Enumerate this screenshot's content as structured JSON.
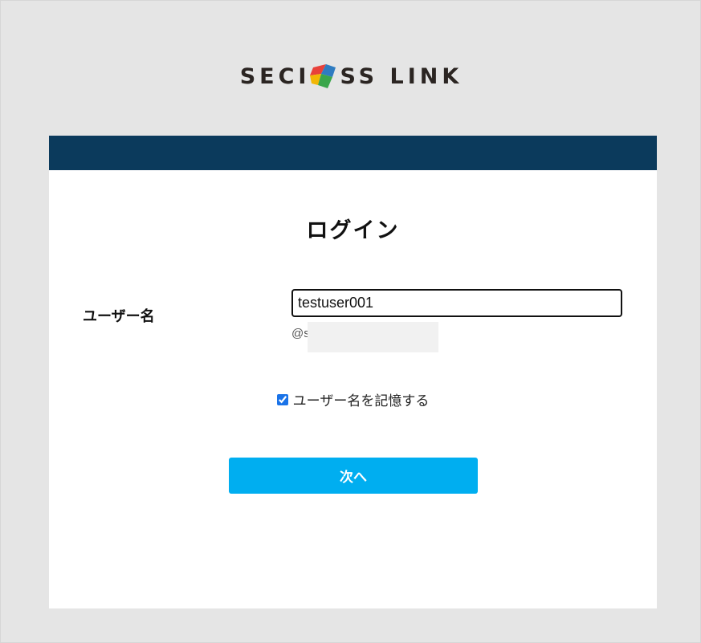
{
  "brand": {
    "logo_left": "SECI",
    "logo_right": "SS LINK",
    "logo_alt": "SECIOSS LINK"
  },
  "login": {
    "title": "ログイン",
    "username_label": "ユーザー名",
    "username_value": "testuser001",
    "domain_hint": "@s",
    "remember_label": "ユーザー名を記憶する",
    "remember_checked": true,
    "next_button": "次へ"
  },
  "colors": {
    "page_background": "#e5e5e5",
    "header_bar": "#0b3a5c",
    "primary_button": "#00aef0",
    "checkbox_accent": "#1a73e8"
  }
}
